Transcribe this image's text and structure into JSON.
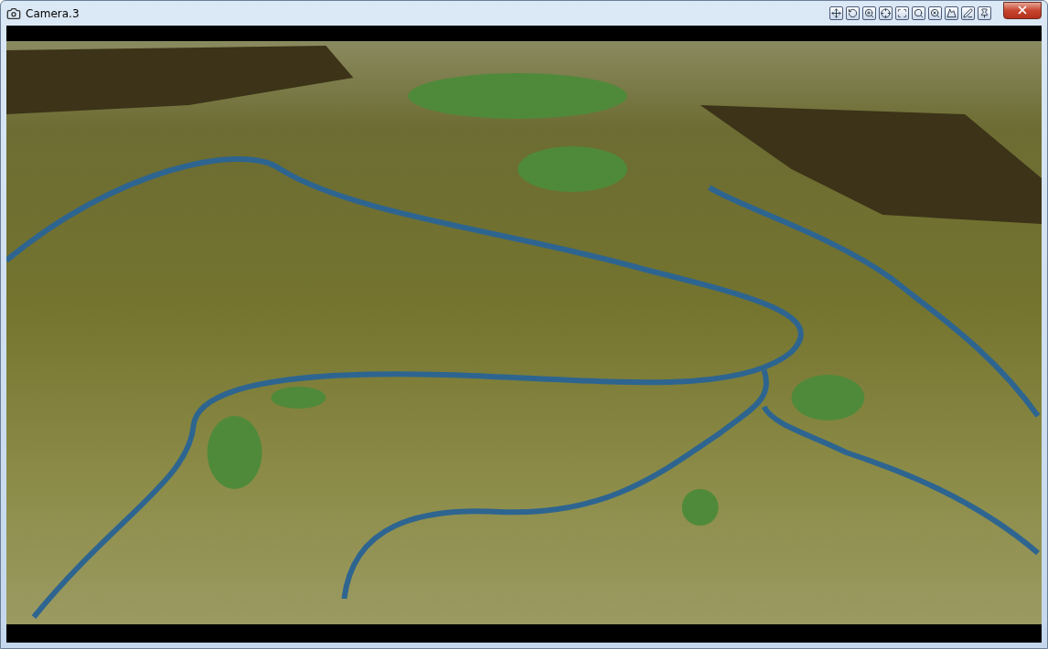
{
  "window": {
    "title": "Camera.3"
  }
}
